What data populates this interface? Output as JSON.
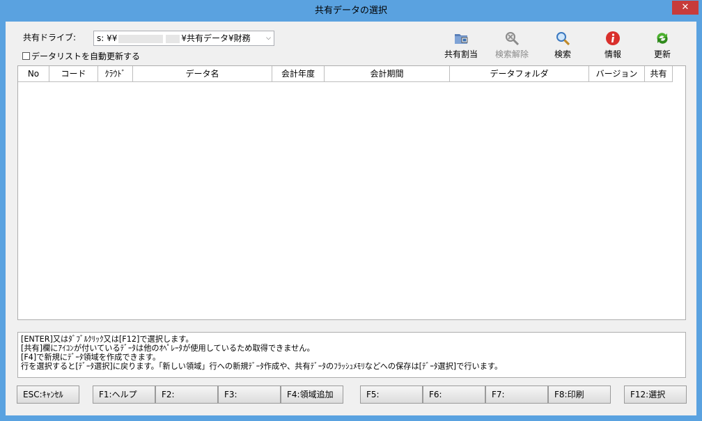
{
  "window": {
    "title": "共有データの選択",
    "close_glyph": "✕"
  },
  "drive": {
    "label": "共有ドライブ:",
    "value_prefix": "s: ¥¥",
    "value_suffix": "¥共有データ¥財務",
    "arrow": "⌵"
  },
  "auto_refresh": {
    "label": "データリストを自動更新する",
    "checked": false
  },
  "toolbar": [
    {
      "label": "共有割当",
      "icon": "share-folder-icon",
      "enabled": true
    },
    {
      "label": "検索解除",
      "icon": "clear-search-icon",
      "enabled": false
    },
    {
      "label": "検索",
      "icon": "search-icon",
      "enabled": true
    },
    {
      "label": "情報",
      "icon": "info-icon",
      "enabled": true
    },
    {
      "label": "更新",
      "icon": "refresh-icon",
      "enabled": true
    }
  ],
  "grid": {
    "columns": [
      "No",
      "コード",
      "ｸﾗｳﾄﾞ",
      "データ名",
      "会計年度",
      "会計期間",
      "データフォルダ",
      "バージョン",
      "共有"
    ],
    "rows": []
  },
  "help_lines": [
    "[ENTER]又はﾀﾞﾌﾞﾙｸﾘｯｸ又は[F12]で選択します。",
    "[共有]欄にｱｲｺﾝが付いているﾃﾞｰﾀは他のｵﾍﾟﾚｰﾀが使用しているため取得できません。",
    "[F4]で新規にﾃﾞｰﾀ領域を作成できます。",
    "行を選択すると[ﾃﾞｰﾀ選択]に戻ります。「新しい領域」行への新規ﾃﾞｰﾀ作成や、共有ﾃﾞｰﾀのﾌﾗｯｼｭﾒﾓﾘなどへの保存は[ﾃﾞｰﾀ選択]で行います。"
  ],
  "fkeys": [
    {
      "label": "ESC:ｷｬﾝｾﾙ"
    },
    {
      "label": "F1:ヘルプ"
    },
    {
      "label": "F2:"
    },
    {
      "label": "F3:"
    },
    {
      "label": "F4:領域追加"
    },
    {
      "label": "F5:"
    },
    {
      "label": "F6:"
    },
    {
      "label": "F7:"
    },
    {
      "label": "F8:印刷"
    },
    {
      "label": "F12:選択"
    }
  ],
  "colors": {
    "title_bar": "#5aa2e0",
    "close_button": "#c73b3b",
    "info_icon": "#d9302c",
    "refresh_icon": "#4caf2f"
  }
}
